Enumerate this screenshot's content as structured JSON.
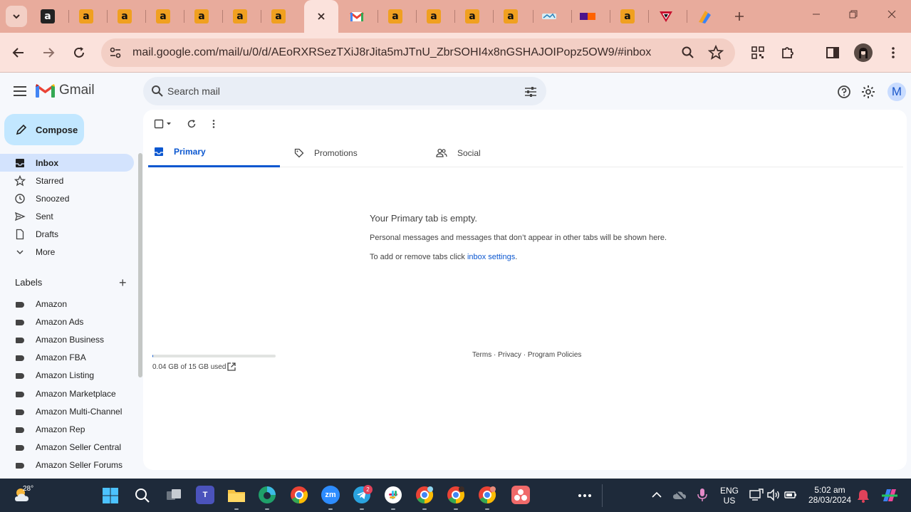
{
  "browser": {
    "url": "mail.google.com/mail/u/0/d/AEoRXRSezTXiJ8rJita5mJTnU_ZbrSOHI4x8nGSHAJOIPopz5OW9/#inbox",
    "tab_glyph": "a"
  },
  "gmail": {
    "logo_text": "Gmail",
    "search_placeholder": "Search mail",
    "avatar_letter": "M",
    "compose_label": "Compose"
  },
  "nav": {
    "items": [
      {
        "label": "Inbox",
        "icon": "inbox-icon",
        "active": true
      },
      {
        "label": "Starred",
        "icon": "star-icon"
      },
      {
        "label": "Snoozed",
        "icon": "clock-icon"
      },
      {
        "label": "Sent",
        "icon": "send-icon"
      },
      {
        "label": "Drafts",
        "icon": "draft-icon"
      },
      {
        "label": "More",
        "icon": "chevron-down-icon"
      }
    ],
    "labels_title": "Labels",
    "labels_add": "+",
    "labels": [
      "Amazon",
      "Amazon Ads",
      "Amazon Business",
      "Amazon FBA",
      "Amazon Listing",
      "Amazon Marketplace",
      "Amazon Multi-Channel",
      "Amazon Rep",
      "Amazon Seller Central",
      "Amazon Seller Forums"
    ]
  },
  "inbox": {
    "tabs": [
      {
        "label": "Primary",
        "icon": "inbox-icon",
        "active": true
      },
      {
        "label": "Promotions",
        "icon": "tag-icon"
      },
      {
        "label": "Social",
        "icon": "people-icon"
      }
    ],
    "empty_title": "Your Primary tab is empty.",
    "empty_message": "Personal messages and messages that don’t appear in other tabs will be shown here.",
    "settings_prefix": "To add or remove tabs click ",
    "settings_link": "inbox settings",
    "settings_suffix": "."
  },
  "storage": {
    "used_text": "0.04 GB of 15 GB used",
    "used_fraction": 0.003
  },
  "footer": {
    "terms": "Terms",
    "sep": " · ",
    "privacy": "Privacy",
    "policies": "Program Policies"
  },
  "taskbar": {
    "temperature": "28°",
    "telegram_badge": "2",
    "language": "ENG",
    "region": "US",
    "time": "5:02 am",
    "date": "28/03/2024"
  },
  "colors": {
    "browser_frame": "#e8ab9c",
    "accent": "#0b57d0",
    "compose": "#c2e7ff",
    "active_nav": "#d3e3fd"
  }
}
